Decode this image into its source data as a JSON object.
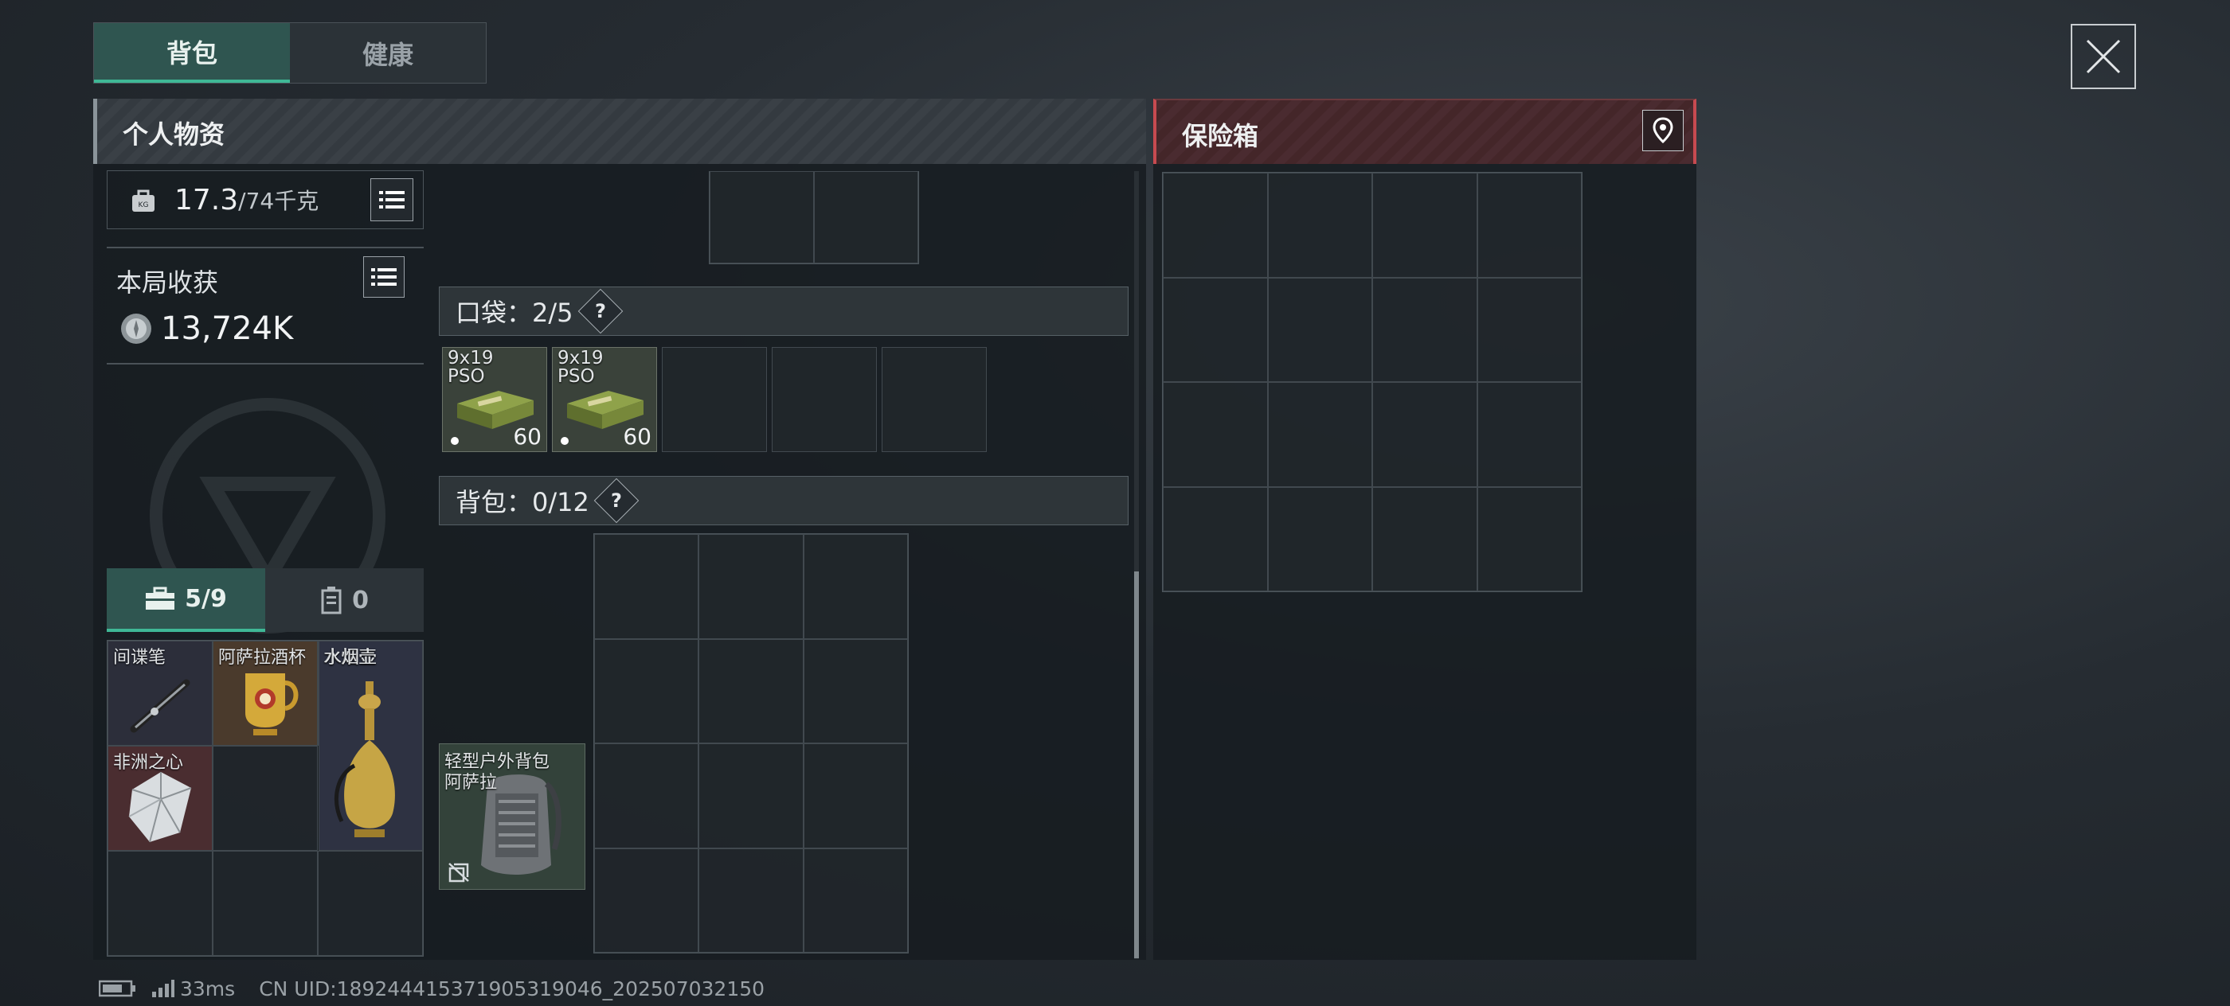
{
  "tabs": [
    {
      "label": "背包",
      "active": true
    },
    {
      "label": "健康",
      "active": false
    }
  ],
  "personal": {
    "title": "个人物资",
    "weight_value": "17.3",
    "weight_max": "/74千克",
    "harvest_label": "本局收获",
    "harvest_value": "13,724K"
  },
  "safe_box": {
    "title": "保险箱"
  },
  "pocket": {
    "label": "口袋：2/5",
    "help": "?",
    "items": [
      {
        "name": "9x19 PSO",
        "count": "60"
      },
      {
        "name": "9x19 PSO",
        "count": "60"
      }
    ]
  },
  "backpack": {
    "label": "背包：0/12",
    "help": "?",
    "equipped_name": "轻型户外背包",
    "equipped_sub": "阿萨拉"
  },
  "container_tabs": [
    {
      "label": "5/9",
      "icon": "toolbox-icon",
      "active": true
    },
    {
      "label": "0",
      "icon": "canister-icon",
      "active": false
    }
  ],
  "valuables": [
    {
      "name": "间谍笔",
      "icon": "spy-pen-icon"
    },
    {
      "name": "阿萨拉酒杯",
      "icon": "gold-goblet-icon"
    },
    {
      "name": "水烟壶",
      "icon": "hookah-icon"
    },
    {
      "name": "非洲之心",
      "icon": "diamond-icon"
    }
  ],
  "status": {
    "ping": "33ms",
    "uid": "CN UID:18924441537190531​9046_202507032150"
  },
  "colors": {
    "accent": "#3fb896",
    "safe_red": "#c74a50"
  }
}
